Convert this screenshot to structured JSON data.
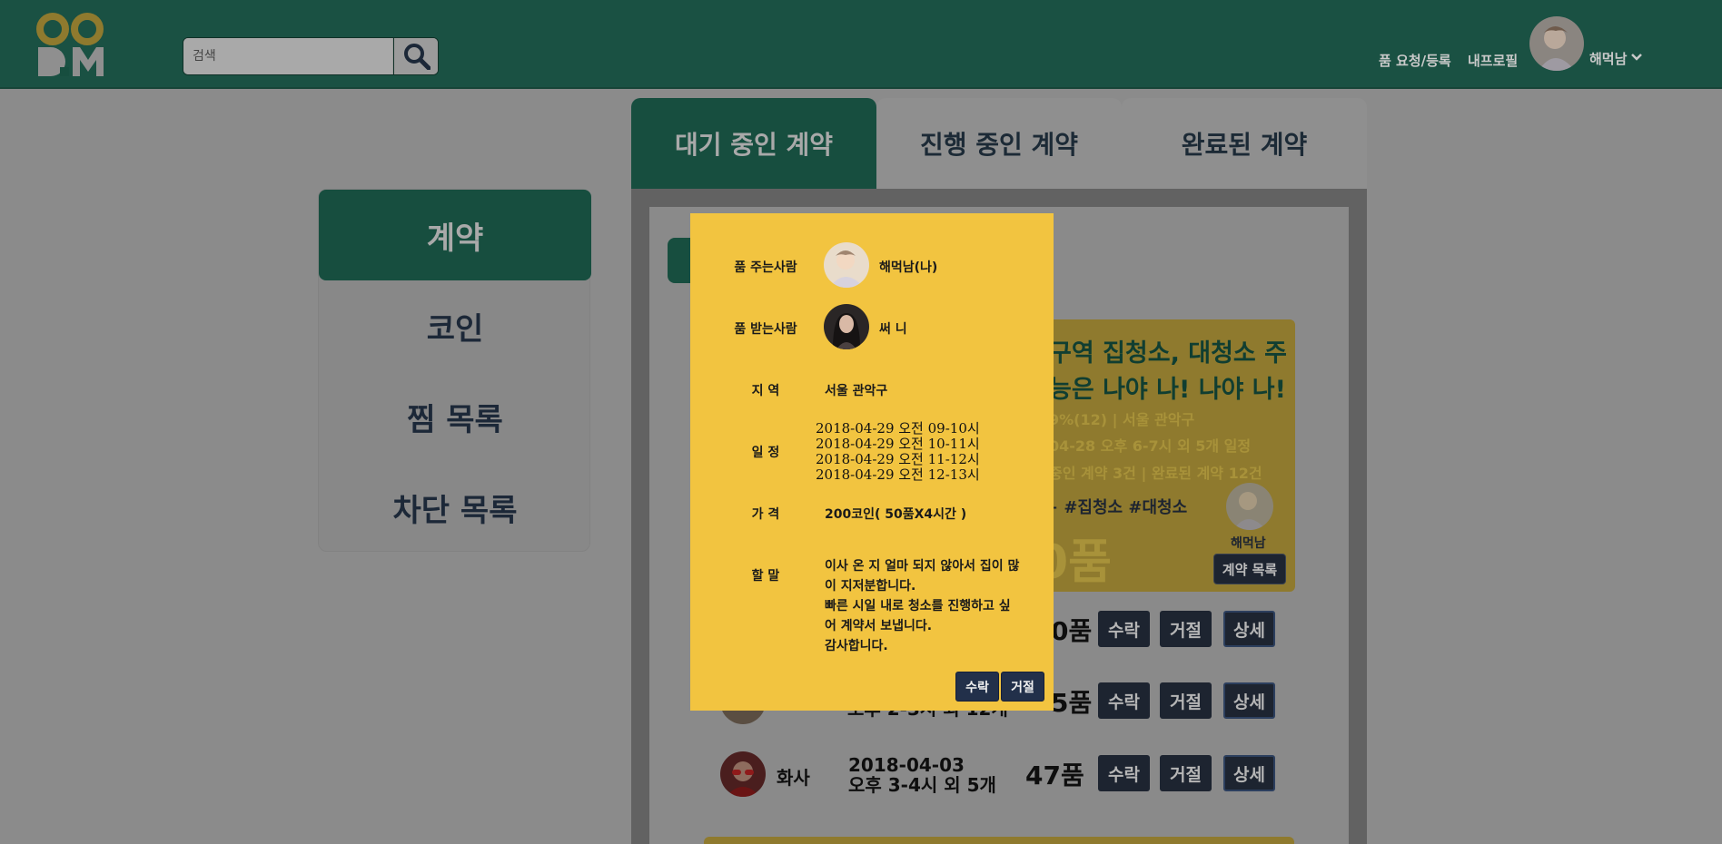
{
  "header": {
    "search": {
      "placeholder": "검색",
      "value": ""
    },
    "nav": {
      "request_register": "품 요청/등록",
      "my_profile": "내프로필"
    },
    "user": {
      "name": "해먹남"
    }
  },
  "tabs": [
    {
      "label": "대기 중인 계약",
      "active": true
    },
    {
      "label": "진행 중인 계약",
      "active": false
    },
    {
      "label": "완료된 계약",
      "active": false
    }
  ],
  "side_menu": [
    {
      "label": "계약",
      "active": true
    },
    {
      "label": "코인"
    },
    {
      "label": "찜 목록"
    },
    {
      "label": "차단 목록"
    }
  ],
  "card": {
    "title_1": "구역 집청소, 대청소 주",
    "title_2": "능은 나야 나! 나야 나!",
    "line_1": "9%(12) | 서울 관악구",
    "line_2": "04-28 오후 6-7시 외 5개 일정",
    "line_3": "중인 계약 3건 | 완료된 계약 12건",
    "tags": "+ #집청소 #대청소",
    "price": "0품",
    "owner": "해먹남",
    "contract_list_label": "계약 목록"
  },
  "rows": [
    {
      "name": "",
      "date_1": "",
      "date_2": "",
      "price": "0품",
      "accept": "수락",
      "reject": "거절",
      "detail": "상세"
    },
    {
      "name": "",
      "date_1": "",
      "date_2": "오후 2-3시 외 12개",
      "price": "5품",
      "accept": "수락",
      "reject": "거절",
      "detail": "상세"
    },
    {
      "name": "화사",
      "date_1": "2018-04-03",
      "date_2": "오후 3-4시 외 5개",
      "price": "47품",
      "accept": "수락",
      "reject": "거절",
      "detail": "상세"
    }
  ],
  "modal": {
    "giver_label": "품 주는사람",
    "giver_name": "해먹남(나)",
    "receiver_label": "품 받는사람",
    "receiver_name": "써 니",
    "region_label": "지 역",
    "region_value": "서울 관악구",
    "schedule_label": "일 정",
    "schedule": [
      "2018-04-29 오전 09-10시",
      "2018-04-29 오전 10-11시",
      "2018-04-29 오전 11-12시",
      "2018-04-29 오전 12-13시"
    ],
    "price_label": "가 격",
    "price_value": "200코인( 50품X4시간 )",
    "message_label": "할 말",
    "message": [
      "이사 온 지 얼마 되지 않아서 집이 많",
      "이 지저분합니다.",
      "빠른 시일 내로 청소를 진행하고 싶",
      "어 계약서 보냅니다.",
      "감사합니다."
    ],
    "accept": "수락",
    "reject": "거절"
  },
  "colors": {
    "header_bg": "#1a5143",
    "active_green": "#174e3f",
    "modal_yellow": "#f2c440",
    "button_navy": "#1d2430"
  }
}
